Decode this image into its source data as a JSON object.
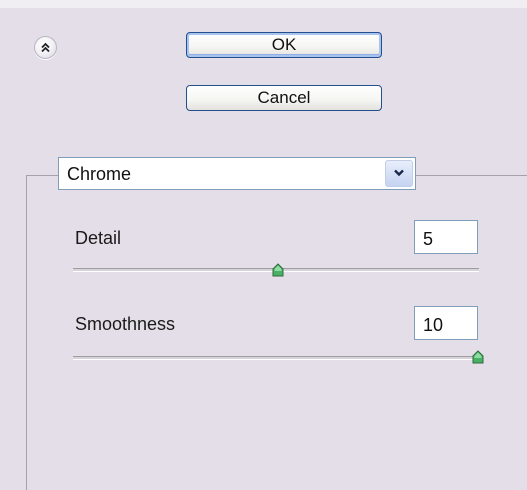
{
  "header": {
    "collapse_icon": "double-chevron-up-icon",
    "ok_label": "OK",
    "cancel_label": "Cancel"
  },
  "filter": {
    "selected": "Chrome",
    "dropdown_icon": "chevron-down-icon"
  },
  "params": {
    "detail": {
      "label": "Detail",
      "value": "5",
      "slider_fraction": 0.5
    },
    "smoothness": {
      "label": "Smoothness",
      "value": "10",
      "slider_fraction": 1.0
    }
  },
  "colors": {
    "panel_bg": "#e3dee7",
    "button_border": "#244f8f",
    "slider_thumb": "#3fa65a"
  }
}
